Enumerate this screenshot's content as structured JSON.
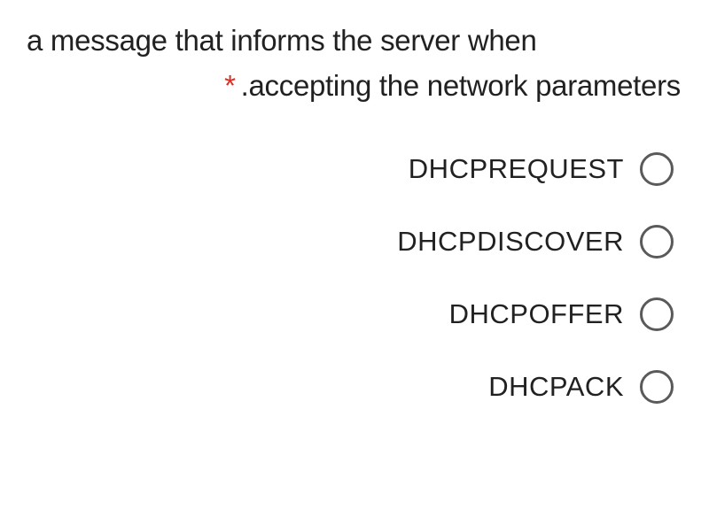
{
  "question": {
    "line1": "a message that informs the server when",
    "line2": ".accepting the network parameters",
    "required_marker": "*"
  },
  "options": [
    {
      "label": "DHCPREQUEST"
    },
    {
      "label": "DHCPDISCOVER"
    },
    {
      "label": "DHCPOFFER"
    },
    {
      "label": "DHCPACK"
    }
  ]
}
